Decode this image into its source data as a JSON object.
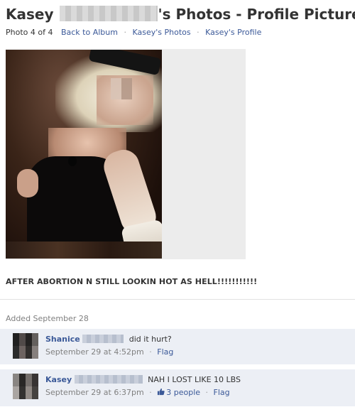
{
  "header": {
    "title_name": "Kasey",
    "title_rest": "'s Photos - Profile Pictures"
  },
  "subnav": {
    "photo_count": "Photo 4 of 4",
    "links": [
      "Back to Album",
      "Kasey's Photos",
      "Kasey's Profile"
    ],
    "separator": "·"
  },
  "photo": {
    "caption": "AFTER ABORTION N STILL LOOKIN HOT AS HELL!!!!!!!!!!!",
    "added": "Added September 28"
  },
  "comments": [
    {
      "name": "Shanice",
      "text": "did it hurt?",
      "timestamp": "September 29 at 4:52pm",
      "actions": [
        "Flag"
      ]
    },
    {
      "name": "Kasey",
      "text": "NAH I LOST LIKE 10 LBS",
      "timestamp": "September 29 at 6:37pm",
      "likes": "3 people",
      "actions": [
        "Flag"
      ]
    }
  ],
  "colors": {
    "link": "#3b5998",
    "comment_bg": "#eceff5",
    "muted": "#808080",
    "text": "#333333"
  },
  "icons": {
    "like": "thumbs-up-icon"
  }
}
